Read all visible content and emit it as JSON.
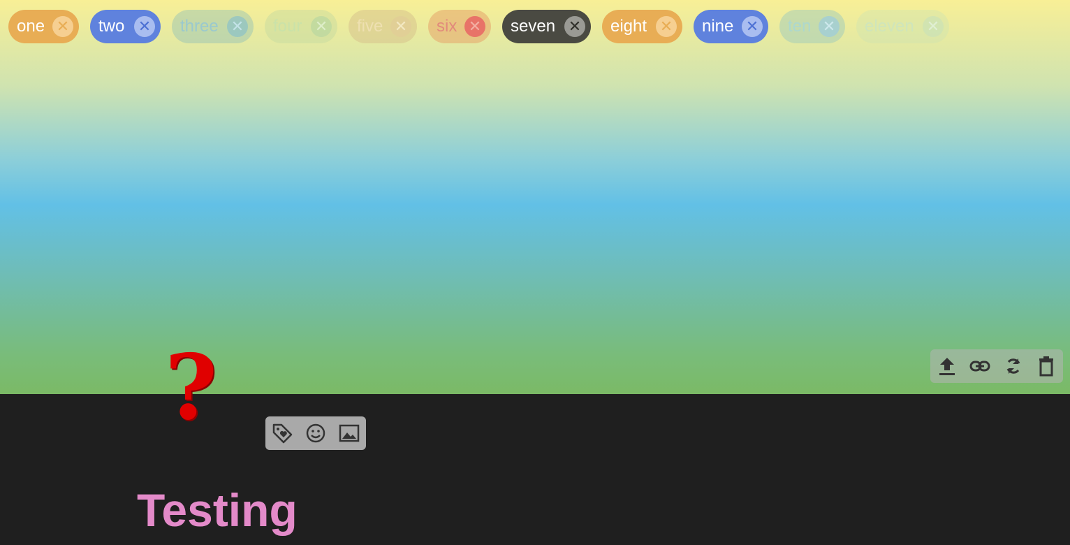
{
  "tags": [
    {
      "label": "one",
      "close_icon": "close-circle-icon",
      "color": "#e8ad55"
    },
    {
      "label": "two",
      "close_icon": "close-circle-icon",
      "color": "#5f82dd"
    },
    {
      "label": "three",
      "close_icon": "close-circle-icon"
    },
    {
      "label": "four",
      "close_icon": "close-circle-icon"
    },
    {
      "label": "five",
      "close_icon": "close-circle-icon"
    },
    {
      "label": "six",
      "close_icon": "close-circle-icon"
    },
    {
      "label": "seven",
      "close_icon": "close-circle-icon",
      "color": "#4a4a42"
    },
    {
      "label": "eight",
      "close_icon": "close-circle-icon",
      "color": "#e8ad55"
    },
    {
      "label": "nine",
      "close_icon": "close-circle-icon",
      "color": "#5f82dd"
    },
    {
      "label": "ten",
      "close_icon": "close-circle-icon"
    },
    {
      "label": "eleven",
      "close_icon": "close-circle-icon"
    }
  ],
  "question_mark": {
    "glyph": "?",
    "color": "#e00000"
  },
  "image_toolbar": {
    "icons": [
      "upload-icon",
      "link-icon",
      "refresh-icon",
      "trash-icon"
    ]
  },
  "insert_toolbar": {
    "icons": [
      "tag-heart-icon",
      "emoji-icon",
      "image-icon"
    ]
  },
  "title": {
    "text": "Testing",
    "color": "#e38ac9"
  }
}
